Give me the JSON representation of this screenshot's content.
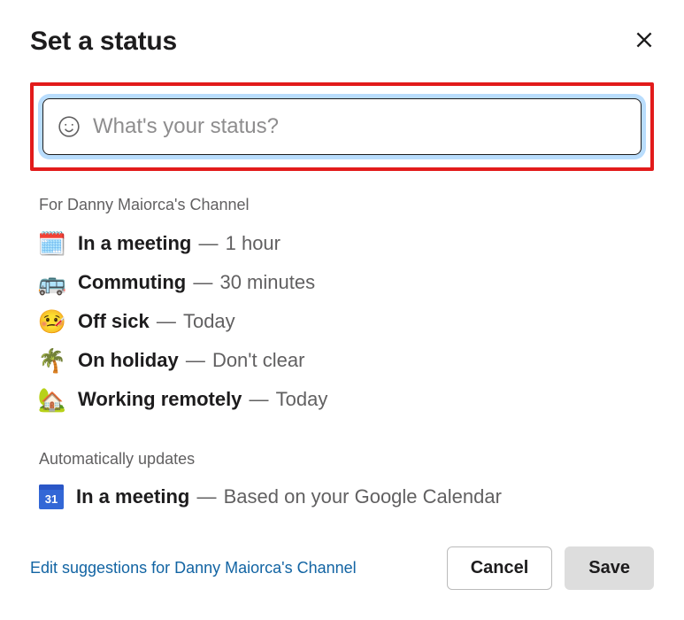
{
  "header": {
    "title": "Set a status"
  },
  "input": {
    "placeholder": "What's your status?",
    "value": ""
  },
  "section1": {
    "label": "For Danny Maiorca's Channel",
    "items": [
      {
        "emoji": "🗓️",
        "label": "In a meeting",
        "duration": "1 hour"
      },
      {
        "emoji": "🚌",
        "label": "Commuting",
        "duration": "30 minutes"
      },
      {
        "emoji": "🤒",
        "label": "Off sick",
        "duration": "Today"
      },
      {
        "emoji": "🌴",
        "label": "On holiday",
        "duration": "Don't clear"
      },
      {
        "emoji": "🏡",
        "label": "Working remotely",
        "duration": "Today"
      }
    ]
  },
  "section2": {
    "label": "Automatically updates",
    "items": [
      {
        "calendar_day": "31",
        "label": "In a meeting",
        "duration": "Based on your Google Calendar"
      }
    ]
  },
  "footer": {
    "edit_link": "Edit suggestions for Danny Maiorca's Channel",
    "cancel": "Cancel",
    "save": "Save"
  }
}
